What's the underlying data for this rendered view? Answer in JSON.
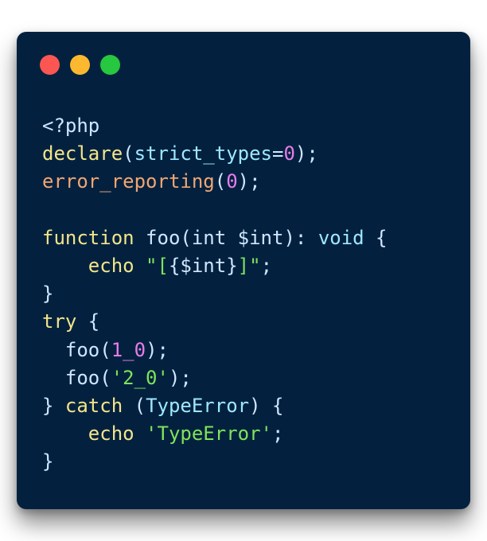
{
  "window": {
    "buttons": [
      {
        "name": "close",
        "color": "#fc5652"
      },
      {
        "name": "minimize",
        "color": "#fdb830"
      },
      {
        "name": "zoom",
        "color": "#27c73f"
      }
    ]
  },
  "theme": {
    "background": "#03213f",
    "plain": "#cfe6ff",
    "keyword": "#f3e58a",
    "orange": "#f0a673",
    "number": "#e77de9",
    "string": "#7fe35a",
    "cyan": "#9fe8ff"
  },
  "code_lines": [
    [
      {
        "t": "<?php",
        "c": "plain"
      }
    ],
    [
      {
        "t": "declare",
        "c": "keyword"
      },
      {
        "t": "(",
        "c": "plain"
      },
      {
        "t": "strict_types",
        "c": "cyan"
      },
      {
        "t": "=",
        "c": "plain"
      },
      {
        "t": "0",
        "c": "number"
      },
      {
        "t": ");",
        "c": "plain"
      }
    ],
    [
      {
        "t": "error_reporting",
        "c": "orange"
      },
      {
        "t": "(",
        "c": "plain"
      },
      {
        "t": "0",
        "c": "number"
      },
      {
        "t": ");",
        "c": "plain"
      }
    ],
    [],
    [
      {
        "t": "function",
        "c": "keyword"
      },
      {
        "t": " foo(",
        "c": "plain"
      },
      {
        "t": "int",
        "c": "plain"
      },
      {
        "t": " $int",
        "c": "plain"
      },
      {
        "t": "): ",
        "c": "plain"
      },
      {
        "t": "void",
        "c": "cyan"
      },
      {
        "t": " {",
        "c": "plain"
      }
    ],
    [
      {
        "t": "    ",
        "c": "plain"
      },
      {
        "t": "echo",
        "c": "keyword"
      },
      {
        "t": " ",
        "c": "plain"
      },
      {
        "t": "\"[",
        "c": "string"
      },
      {
        "t": "{$int}",
        "c": "plain"
      },
      {
        "t": "]\"",
        "c": "string"
      },
      {
        "t": ";",
        "c": "plain"
      }
    ],
    [
      {
        "t": "}",
        "c": "plain"
      }
    ],
    [
      {
        "t": "try",
        "c": "keyword"
      },
      {
        "t": " {",
        "c": "plain"
      }
    ],
    [
      {
        "t": "  foo(",
        "c": "plain"
      },
      {
        "t": "1_0",
        "c": "number"
      },
      {
        "t": ");",
        "c": "plain"
      }
    ],
    [
      {
        "t": "  foo(",
        "c": "plain"
      },
      {
        "t": "'2_0'",
        "c": "string"
      },
      {
        "t": ");",
        "c": "plain"
      }
    ],
    [
      {
        "t": "} ",
        "c": "plain"
      },
      {
        "t": "catch",
        "c": "keyword"
      },
      {
        "t": " (",
        "c": "plain"
      },
      {
        "t": "TypeError",
        "c": "cyan"
      },
      {
        "t": ") {",
        "c": "plain"
      }
    ],
    [
      {
        "t": "    ",
        "c": "plain"
      },
      {
        "t": "echo",
        "c": "keyword"
      },
      {
        "t": " ",
        "c": "plain"
      },
      {
        "t": "'TypeError'",
        "c": "string"
      },
      {
        "t": ";",
        "c": "plain"
      }
    ],
    [
      {
        "t": "}",
        "c": "plain"
      }
    ]
  ]
}
